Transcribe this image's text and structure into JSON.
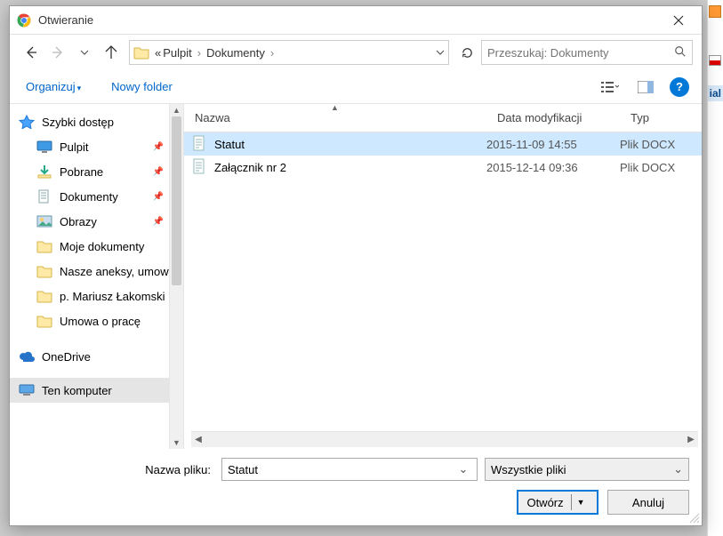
{
  "window": {
    "title": "Otwieranie"
  },
  "breadcrumb": {
    "prefix": "«",
    "items": [
      "Pulpit",
      "Dokumenty"
    ]
  },
  "search": {
    "placeholder": "Przeszukaj: Dokumenty"
  },
  "toolbar": {
    "organize": "Organizuj",
    "newfolder": "Nowy folder"
  },
  "tree": {
    "quickaccess": "Szybki dostęp",
    "items": [
      {
        "label": "Pulpit",
        "pinned": true
      },
      {
        "label": "Pobrane",
        "pinned": true
      },
      {
        "label": "Dokumenty",
        "pinned": true
      },
      {
        "label": "Obrazy",
        "pinned": true
      },
      {
        "label": "Moje dokumenty",
        "pinned": false
      },
      {
        "label": "Nasze aneksy, umowy",
        "pinned": false
      },
      {
        "label": "p. Mariusz Łakomski",
        "pinned": false
      },
      {
        "label": "Umowa o pracę",
        "pinned": false
      }
    ],
    "onedrive": "OneDrive",
    "thispc": "Ten komputer"
  },
  "columns": {
    "name": "Nazwa",
    "date": "Data modyfikacji",
    "type": "Typ"
  },
  "files": [
    {
      "name": "Statut",
      "date": "2015-11-09 14:55",
      "type": "Plik DOCX",
      "selected": true
    },
    {
      "name": "Załącznik nr 2",
      "date": "2015-12-14 09:36",
      "type": "Plik DOCX",
      "selected": false
    }
  ],
  "footer": {
    "filename_label": "Nazwa pliku:",
    "filename_value": "Statut",
    "filter": "Wszystkie pliki",
    "open": "Otwórz",
    "cancel": "Anuluj"
  },
  "bg": {
    "ial": "ial"
  }
}
